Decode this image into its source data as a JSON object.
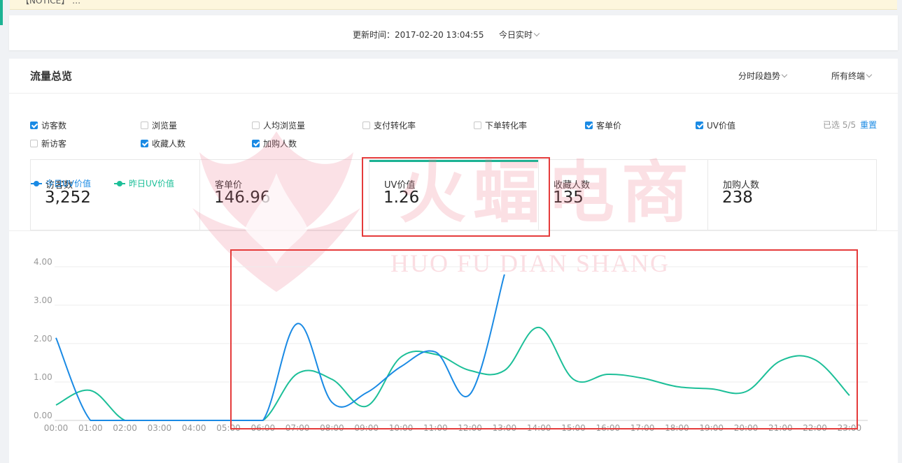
{
  "notice": {
    "text": "【NOTICE】 …"
  },
  "topbar": {
    "update_time": "更新时间：2017-02-20 13:04:55",
    "period": "今日实时"
  },
  "panel": {
    "title": "流量总览",
    "trend_select": "分时段趋势",
    "terminal_select": "所有终端",
    "selected_text": "已选 5/5",
    "reset": "重置"
  },
  "checkboxes": [
    {
      "label": "访客数",
      "checked": true
    },
    {
      "label": "浏览量",
      "checked": false
    },
    {
      "label": "人均浏览量",
      "checked": false
    },
    {
      "label": "支付转化率",
      "checked": false
    },
    {
      "label": "下单转化率",
      "checked": false
    },
    {
      "label": "客单价",
      "checked": true
    },
    {
      "label": "UV价值",
      "checked": true
    },
    {
      "label": "新访客",
      "checked": false
    },
    {
      "label": "收藏人数",
      "checked": true
    },
    {
      "label": "加购人数",
      "checked": true
    }
  ],
  "metrics": [
    {
      "label": "访客数",
      "value": "3,252"
    },
    {
      "label": "客单价",
      "value": "146.96"
    },
    {
      "label": "UV价值",
      "value": "1.26",
      "active": true
    },
    {
      "label": "收藏人数",
      "value": "135"
    },
    {
      "label": "加购人数",
      "value": "238"
    }
  ],
  "watermark": {
    "main": "火蝠电商",
    "sub": "HUO FU DIAN SHANG"
  },
  "colors": {
    "today": "#1a8ae4",
    "yesterday": "#1cbf98",
    "accent": "#1cb394",
    "highlight": "#e53b3b"
  },
  "chart_data": {
    "type": "line",
    "categories": [
      "00:00",
      "01:00",
      "02:00",
      "03:00",
      "04:00",
      "05:00",
      "06:00",
      "07:00",
      "08:00",
      "09:00",
      "10:00",
      "11:00",
      "12:00",
      "13:00",
      "14:00",
      "15:00",
      "16:00",
      "17:00",
      "18:00",
      "19:00",
      "20:00",
      "21:00",
      "22:00",
      "23:00"
    ],
    "yticks": [
      "0.00",
      "1.00",
      "2.00",
      "3.00",
      "4.00"
    ],
    "ylim": [
      0,
      4
    ],
    "series": [
      {
        "name": "今日UV价值",
        "values": [
          2.15,
          0,
          0,
          0,
          0,
          0,
          0,
          2.52,
          0.47,
          0.72,
          1.4,
          1.78,
          0.68,
          3.8
        ]
      },
      {
        "name": "昨日UV价值",
        "values": [
          0.4,
          0.78,
          0,
          0,
          0,
          0,
          0,
          1.22,
          1.07,
          0.37,
          1.65,
          1.72,
          1.3,
          1.3,
          2.42,
          1.07,
          1.2,
          1.1,
          0.88,
          0.82,
          0.75,
          1.55,
          1.58,
          0.65
        ]
      }
    ],
    "legend": "top-left",
    "grid": true
  }
}
